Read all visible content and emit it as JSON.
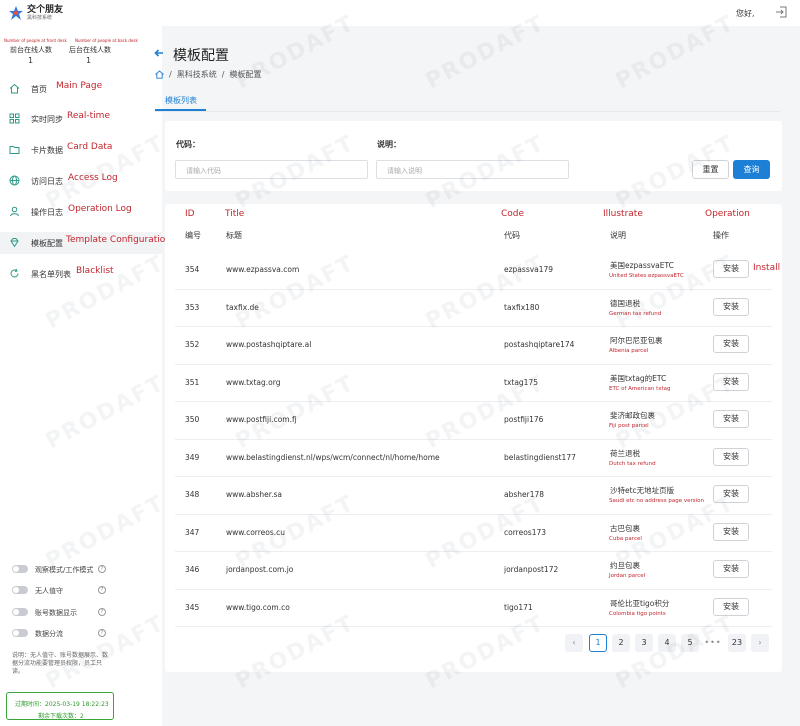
{
  "header": {
    "brand_title": "交个朋友",
    "brand_subtitle": "黑科技系统",
    "greeting": "您好,"
  },
  "online": {
    "front_note": "Number of people at front desk",
    "back_note": "Number of people at back desk",
    "front_label": "前台在线人数",
    "back_label": "后台在线人数",
    "front_count": "1",
    "back_count": "1"
  },
  "sidebar": {
    "items": [
      {
        "label": "首页",
        "en": "Main Page",
        "icon": "home-icon"
      },
      {
        "label": "实时同步",
        "en": "Real-time",
        "icon": "grid-icon"
      },
      {
        "label": "卡片数据",
        "en": "Card Data",
        "icon": "folder-icon"
      },
      {
        "label": "访问日志",
        "en": "Access Log",
        "icon": "globe-icon"
      },
      {
        "label": "操作日志",
        "en": "Operation Log",
        "icon": "user-icon"
      },
      {
        "label": "模板配置",
        "en": "Template Configuration",
        "icon": "diamond-icon"
      },
      {
        "label": "黑名单列表",
        "en": "Blacklist",
        "icon": "refresh-icon"
      }
    ],
    "toggles": [
      "观察模式/工作模式",
      "无人值守",
      "账号数据显示",
      "数据分流"
    ],
    "description": "说明：无人值守、账号数据展示、数据分流功能要管理员权限，员工只读。",
    "expire_label": "过期时间：2025-03-19 18:22:23",
    "remaining_downloads": "剩余下载次数：2"
  },
  "page": {
    "title": "模板配置",
    "breadcrumb": [
      "黑科技系统",
      "模板配置"
    ],
    "tab": "模板列表"
  },
  "search": {
    "code_label": "代码：",
    "code_placeholder": "请输入代码",
    "desc_label": "说明：",
    "desc_placeholder": "请输入说明",
    "reset": "重置",
    "query": "查询"
  },
  "table": {
    "english_headers": [
      "ID",
      "Title",
      "Code",
      "Illustrate",
      "Operation"
    ],
    "headers": [
      "编号",
      "标题",
      "代码",
      "说明",
      "操作"
    ],
    "install_label": "安装",
    "install_en": "Install",
    "rows": [
      {
        "id": "354",
        "title": "www.ezpassva.com",
        "code": "ezpassva179",
        "desc": "美国ezpassvaETC",
        "en": "United States ezpassvaETC"
      },
      {
        "id": "353",
        "title": "taxfix.de",
        "code": "taxfix180",
        "desc": "德国退税",
        "en": "German tax refund"
      },
      {
        "id": "352",
        "title": "www.postashqiptare.al",
        "code": "postashqiptare174",
        "desc": "阿尔巴尼亚包裹",
        "en": "Albenia parcel"
      },
      {
        "id": "351",
        "title": "www.txtag.org",
        "code": "txtag175",
        "desc": "美国txtag的ETC",
        "en": "ETC of American txtag"
      },
      {
        "id": "350",
        "title": "www.postfiji.com.fj",
        "code": "postfiji176",
        "desc": "斐济邮政包裹",
        "en": "Fiji post parcel"
      },
      {
        "id": "349",
        "title": "www.belastingdienst.nl/wps/wcm/connect/nl/home/home",
        "code": "belastingdienst177",
        "desc": "荷兰退税",
        "en": "Dutch tax refund"
      },
      {
        "id": "348",
        "title": "www.absher.sa",
        "code": "absher178",
        "desc": "沙特etc无地址页版",
        "en": "Saudi etc no address page version"
      },
      {
        "id": "347",
        "title": "www.correos.cu",
        "code": "correos173",
        "desc": "古巴包裹",
        "en": "Cuba parcel"
      },
      {
        "id": "346",
        "title": "jordanpost.com.jo",
        "code": "jordanpost172",
        "desc": "约旦包裹",
        "en": "Jordan parcel"
      },
      {
        "id": "345",
        "title": "www.tigo.com.co",
        "code": "tigo171",
        "desc": "哥伦比亚tigo积分",
        "en": "Colombia tigo points"
      }
    ]
  },
  "pagination": {
    "pages": [
      "1",
      "2",
      "3",
      "4",
      "5"
    ],
    "ellipsis": "•••",
    "last": "23",
    "prev": "‹",
    "next": "›"
  },
  "watermark": "PRODAFT",
  "colors": {
    "accent": "#1e7fd6",
    "annotation": "#c0262d",
    "success": "#2e9a2e"
  }
}
